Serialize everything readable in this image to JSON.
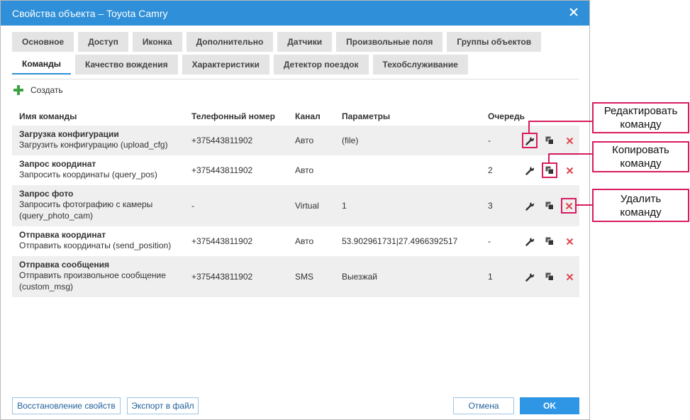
{
  "dialog": {
    "title": "Свойства объекта – Toyota Camry"
  },
  "tabs_row1": [
    "Основное",
    "Доступ",
    "Иконка",
    "Дополнительно",
    "Датчики",
    "Произвольные поля",
    "Группы объектов"
  ],
  "tabs_row2": [
    "Команды",
    "Качество вождения",
    "Характеристики",
    "Детектор поездок",
    "Техобслуживание"
  ],
  "active_tab": "Команды",
  "create_label": "Создать",
  "columns": {
    "name": "Имя команды",
    "phone": "Телефонный номер",
    "channel": "Канал",
    "params": "Параметры",
    "queue": "Очередь"
  },
  "rows": [
    {
      "title": "Загрузка конфигурации",
      "desc": "Загрузить конфигурацию (upload_cfg)",
      "phone": "+375443811902",
      "channel": "Авто",
      "params": "(file)",
      "queue": "-"
    },
    {
      "title": "Запрос координат",
      "desc": "Запросить координаты (query_pos)",
      "phone": "+375443811902",
      "channel": "Авто",
      "params": "",
      "queue": "2"
    },
    {
      "title": "Запрос фото",
      "desc": "Запросить фотографию с камеры (query_photo_cam)",
      "phone": "-",
      "channel": "Virtual",
      "params": "1",
      "queue": "3"
    },
    {
      "title": "Отправка координат",
      "desc": "Отправить координаты (send_position)",
      "phone": "+375443811902",
      "channel": "Авто",
      "params": "53.902961731|27.4966392517",
      "queue": "-"
    },
    {
      "title": "Отправка сообщения",
      "desc": "Отправить произвольное сообщение (custom_msg)",
      "phone": "+375443811902",
      "channel": "SMS",
      "params": "Выезжай",
      "queue": "1"
    }
  ],
  "callouts": {
    "edit": [
      "Редактировать",
      "команду"
    ],
    "copy": [
      "Копировать",
      "команду"
    ],
    "delete": [
      "Удалить",
      "команду"
    ]
  },
  "footer": {
    "restore": "Восстановление свойств",
    "export": "Экспорт в файл",
    "cancel": "Отмена",
    "ok": "OK"
  },
  "icons": {
    "edit": "wrench-icon",
    "copy": "copy-icon",
    "delete": "delete-icon",
    "create": "plus-icon",
    "close": "close-icon"
  },
  "colors": {
    "titlebar": "#2f8fd8",
    "highlight": "#d81b60",
    "delete": "#e0454f",
    "plus": "#3aa241"
  }
}
